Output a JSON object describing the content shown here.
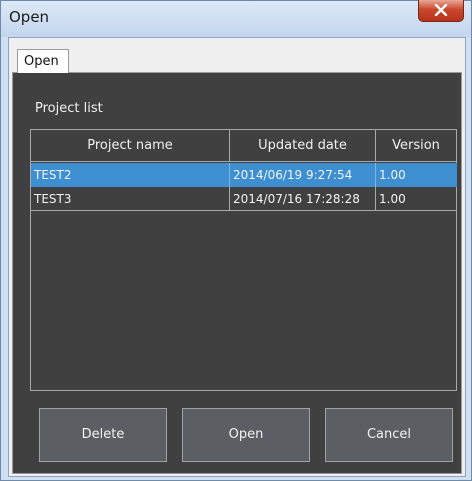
{
  "window": {
    "title": "Open"
  },
  "tabs": [
    {
      "label": "Open",
      "active": true
    }
  ],
  "project_list": {
    "label": "Project list",
    "columns": [
      "Project name",
      "Updated date",
      "Version"
    ],
    "rows": [
      {
        "name": "TEST2",
        "updated": "2014/06/19 9:27:54",
        "version": "1.00",
        "selected": true
      },
      {
        "name": "TEST3",
        "updated": "2014/07/16 17:28:28",
        "version": "1.00",
        "selected": false
      }
    ]
  },
  "buttons": {
    "delete": "Delete",
    "open": "Open",
    "cancel": "Cancel"
  },
  "colors": {
    "selection": "#3d8fd1",
    "panel": "#404040",
    "button": "#5b5f63"
  },
  "icons": {
    "close": "close-icon"
  }
}
